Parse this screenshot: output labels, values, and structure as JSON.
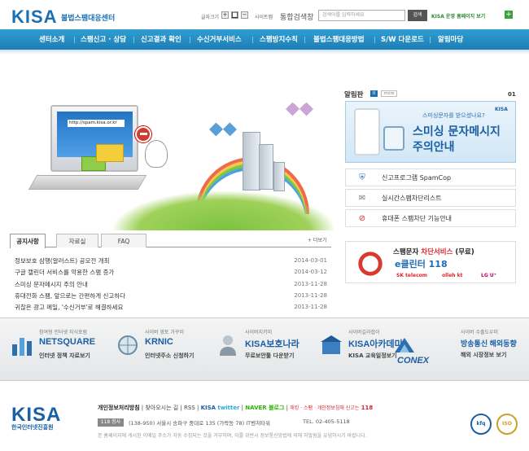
{
  "header": {
    "logo": "KISA",
    "logo_sub": "불법스팸대응센터",
    "font_size_label": "글자크기",
    "font_plus": "+",
    "font_reset": "■",
    "font_minus": "−",
    "sitemap": "사이트맵",
    "search_label": "통합검색창",
    "search_placeholder": "검색어를 입력하세요",
    "search_button": "검색",
    "sns_link": "KISA 운영 홈페이지 보기",
    "plus": "+"
  },
  "nav": [
    "센터소개",
    "스팸신고 · 상담",
    "신고결과 확인",
    "수신거부서비스",
    "스팸방지수칙",
    "불법스팸대응방법",
    "S/W 다운로드",
    "알림마당"
  ],
  "hero": {
    "url": "http://spam.kisa.or.kr"
  },
  "tabs": {
    "items": [
      {
        "label": "공지사항",
        "active": true
      },
      {
        "label": "자료실",
        "active": false
      },
      {
        "label": "FAQ",
        "active": false
      }
    ],
    "more": "+ 더보기"
  },
  "notices": [
    {
      "title": "정보보호 삼행(알러스트) 공모전 개최",
      "date": "2014-03-01"
    },
    {
      "title": "구글 캘린더 서비스를 악용한 스팸 증가",
      "date": "2014-03-12"
    },
    {
      "title": "스미싱 문자메시지 주의 안내",
      "date": "2013-11-28"
    },
    {
      "title": "휴대전화 스팸, 앞으로는 간편하게 신고하다",
      "date": "2013-11-28"
    },
    {
      "title": "귀찮은 광고 메일, '수신거부'로 해결하세요",
      "date": "2013-11-28"
    }
  ],
  "board": {
    "label": "알림판",
    "pause": "II",
    "more": "more",
    "page": "01"
  },
  "banner1": {
    "question": "스미싱문자를 받으셨나요?",
    "line1": "스미싱 문자메시지",
    "line2": "주의안내",
    "kisa": "KISA"
  },
  "quick_links": [
    {
      "icon": "shield-icon",
      "label": "신고프로그램 SpamCop"
    },
    {
      "icon": "list-icon",
      "label": "실시간스팸차단리스트"
    },
    {
      "icon": "block-icon",
      "label": "휴대폰 스팸차단 기능안내"
    }
  ],
  "banner2": {
    "title_prefix": "스팸문자 ",
    "title_hl": "차단서비스",
    "title_suffix": " (무료)",
    "number": "e클린터 118",
    "carriers": [
      "SK telecom",
      "olleh kt",
      "LG U⁺"
    ]
  },
  "sites": [
    {
      "pre": "참여형 인터넷 지식포럼",
      "name": "NETSQUARE",
      "desc": "인터넷 정책 자료보기",
      "icon": "bar-chart-icon"
    },
    {
      "pre": "사이버 영토 가꾸미",
      "name": "KRNIC",
      "desc": "인터넷주소 신청하기",
      "icon": "globe-icon"
    },
    {
      "pre": "사이버지키미",
      "name": "KISA보호나라",
      "desc": "무료보안툴 다운받기",
      "icon": "shield-person-icon"
    },
    {
      "pre": "사이버길라잡이",
      "name": "KISA아카데미",
      "desc": "KISA 교육일정보기",
      "icon": "academy-icon"
    },
    {
      "pre": "",
      "name": "CONEX",
      "desc": "방송통신 해외동향",
      "icon": "conex-icon"
    },
    {
      "pre": "사이버 수출도우미",
      "name": "",
      "desc": "해외 시장정보 보기",
      "icon": "export-icon"
    }
  ],
  "footer": {
    "logo": "KISA",
    "logo_sub": "한국인터넷진흥원",
    "privacy": "개인정보처리방침",
    "directions": "찾아오시는 길",
    "rss": "RSS",
    "kisa": "KISA",
    "twitter": "twitter",
    "naver": "NAVER 블로그",
    "report": "해킹 · 스팸 · 개인정보침해 신고는",
    "hotline": "118",
    "badge": "118 청사",
    "address": "(138-950) 서울시 송파구 중대로 135 (가락동 78) IT벤처타워",
    "tel": "TEL. 02-405-5118",
    "copyright": "본 홈페이지에 게시된 이메일 주소가 자동 수집되는 것을 거부하며, 이를 위반시 정보통신망법에 의해 처벌됨을 유념하시기 바랍니다.",
    "cert1": "kfq",
    "cert2": "ISO"
  },
  "colors": {
    "brand": "#1a6fb5",
    "nav": "#2f9ed2",
    "accent_red": "#d8262d",
    "accent_green": "#3aa23a"
  }
}
